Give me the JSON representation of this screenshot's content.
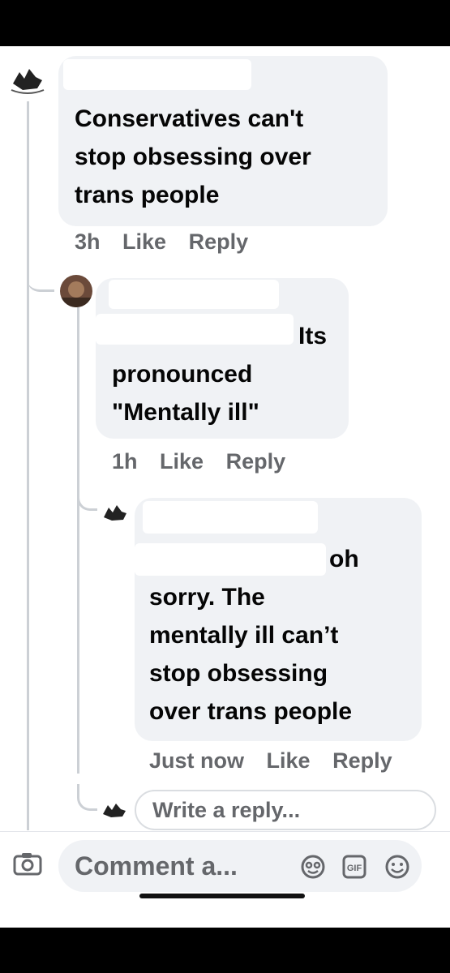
{
  "comments": [
    {
      "text_lines": [
        "Conservatives can't",
        "stop obsessing over",
        "trans people"
      ],
      "meta": {
        "time": "3h",
        "like": "Like",
        "reply": "Reply"
      }
    },
    {
      "text_lines": [
        "Its",
        "pronounced",
        "\"Mentally ill\""
      ],
      "meta": {
        "time": "1h",
        "like": "Like",
        "reply": "Reply"
      }
    },
    {
      "text_lines": [
        "oh",
        "sorry. The",
        "mentally ill can’t",
        "stop obsessing",
        "over trans people"
      ],
      "meta": {
        "time": "Just now",
        "like": "Like",
        "reply": "Reply"
      }
    }
  ],
  "reply_box": {
    "placeholder": "Write a reply..."
  },
  "comment_bar": {
    "placeholder": "Comment a...",
    "icons": [
      "camera-icon",
      "avatar-sticker-icon",
      "gif-icon",
      "emoji-icon"
    ]
  }
}
